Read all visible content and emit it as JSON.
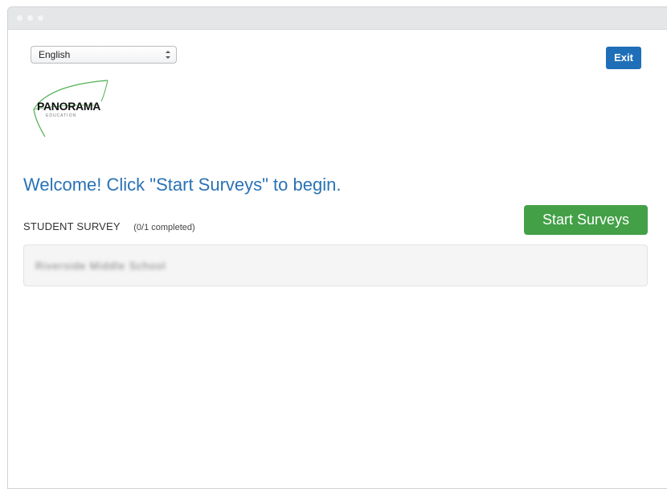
{
  "language_select": {
    "selected": "English"
  },
  "header": {
    "exit_label": "Exit"
  },
  "logo": {
    "name": "PANORAMA",
    "sub": "EDUCATION",
    "color": "#4caf50"
  },
  "main": {
    "welcome": "Welcome! Click \"Start Surveys\" to begin.",
    "start_label": "Start Surveys",
    "survey_title": "STUDENT SURVEY",
    "survey_progress": "(0/1 completed)",
    "survey_item_name": "Riverside Middle School"
  },
  "colors": {
    "primary": "#1f6fb8",
    "success": "#43a047",
    "heading": "#2a72b5"
  }
}
